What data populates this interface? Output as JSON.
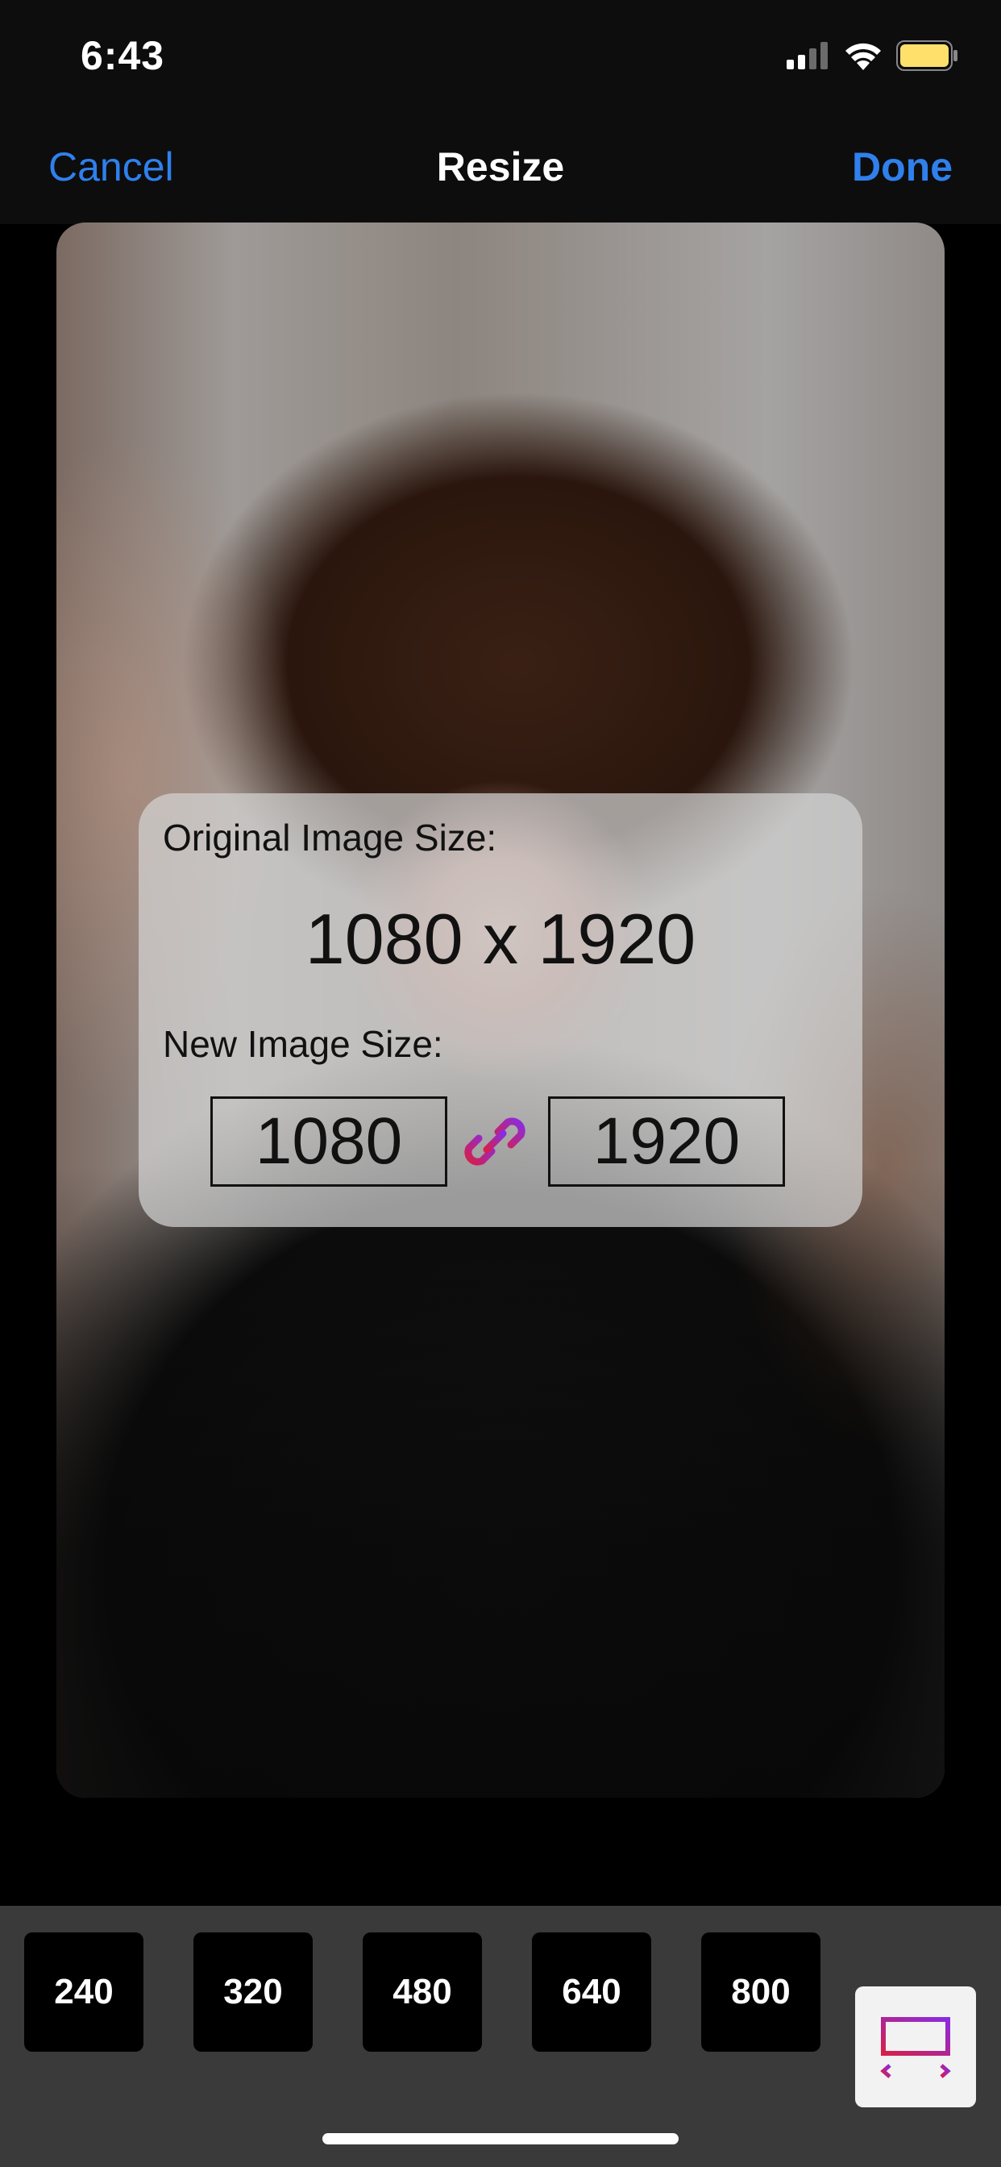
{
  "status_bar": {
    "time": "6:43"
  },
  "nav": {
    "cancel": "Cancel",
    "title": "Resize",
    "done": "Done"
  },
  "panel": {
    "original_label": "Original Image Size:",
    "original_value": "1080 x 1920",
    "new_label": "New Image Size:",
    "new_width": "1080",
    "new_height": "1920"
  },
  "presets": [
    "240",
    "320",
    "480",
    "640",
    "800"
  ],
  "icons": {
    "link": "link-icon",
    "resize": "resize-width-icon",
    "wifi": "wifi-icon",
    "signal": "cellular-signal-icon",
    "battery": "battery-icon"
  },
  "colors": {
    "accent": "#2F80ED",
    "link_gradient_start": "#D61F4A",
    "link_gradient_end": "#8A2BE2",
    "battery": "#FFE06B"
  }
}
